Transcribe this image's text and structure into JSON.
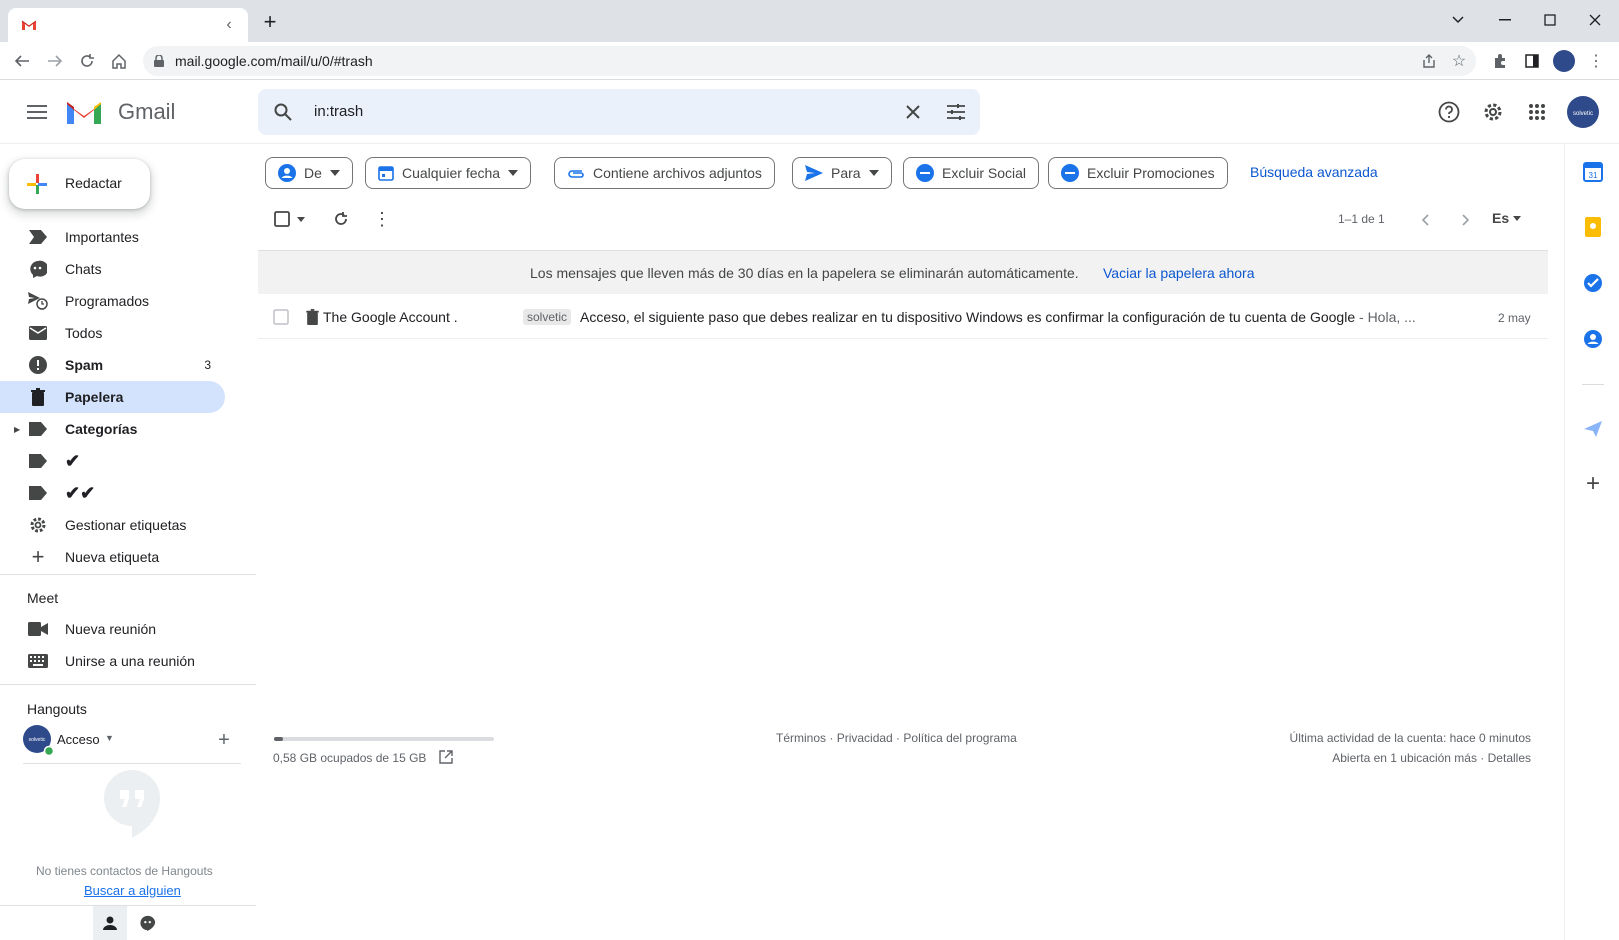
{
  "browser": {
    "tab_title": "",
    "url": "mail.google.com/mail/u/0/#trash"
  },
  "app": {
    "name": "Gmail",
    "search_value": "in:trash"
  },
  "compose": {
    "label": "Redactar"
  },
  "filters": {
    "from": "De",
    "date": "Cualquier fecha",
    "attachments": "Contiene archivos adjuntos",
    "to": "Para",
    "exclude_social": "Excluir Social",
    "exclude_promotions": "Excluir Promociones",
    "advanced": "Búsqueda avanzada"
  },
  "toolbar": {
    "pagination": "1–1 de 1",
    "language": "Es"
  },
  "nav": {
    "important": "Importantes",
    "chats": "Chats",
    "scheduled": "Programados",
    "all": "Todos",
    "spam": "Spam",
    "spam_count": "3",
    "trash": "Papelera",
    "categories": "Categorías",
    "label1": "✔",
    "label2": "✔✔",
    "manage_labels": "Gestionar etiquetas",
    "new_label": "Nueva etiqueta"
  },
  "meet": {
    "title": "Meet",
    "new_meeting": "Nueva reunión",
    "join_meeting": "Unirse a una reunión"
  },
  "hangouts": {
    "title": "Hangouts",
    "user": "Acceso",
    "avatar_text": "solvetic",
    "no_contacts": "No tienes contactos de Hangouts",
    "find_someone": "Buscar a alguien"
  },
  "trash_notice": {
    "text": "Los mensajes que lleven más de 30 días en la papelera se eliminarán automáticamente.",
    "empty_link": "Vaciar la papelera ahora"
  },
  "emails": [
    {
      "sender": "The Google Account .",
      "label": "solvetic",
      "subject": "Acceso, el siguiente paso que debes realizar en tu dispositivo Windows es confirmar la configuración de tu cuenta de Google",
      "snippet": " - Hola, ...",
      "date": "2 may"
    }
  ],
  "footer": {
    "storage": "0,58 GB ocupados de 15 GB",
    "storage_fraction": 0.04,
    "terms": "Términos",
    "privacy": "Privacidad",
    "program": "Política del programa",
    "sep": " · ",
    "last_activity": "Última actividad de la cuenta: hace 0 minutos",
    "open_in": "Abierta en 1 ubicación más",
    "details": "Detalles"
  },
  "colors": {
    "accent": "#0b57d0",
    "selected_bg": "#d3e3fd",
    "chip_blue": "#1a73e8"
  }
}
